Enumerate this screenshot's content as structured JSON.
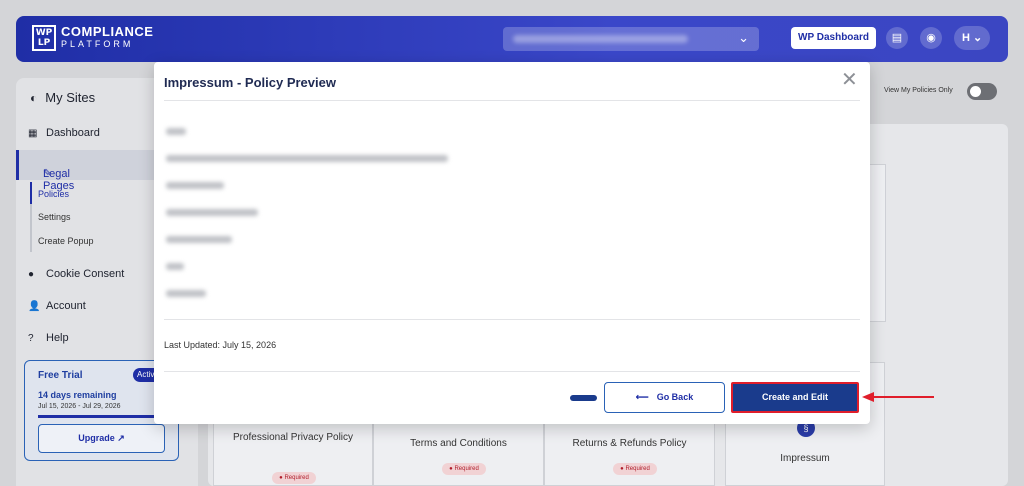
{
  "header": {
    "logo_mark": "WP LP",
    "logo_line1": "COMPLIANCE",
    "logo_line2": "PLATFORM",
    "wp_dashboard": "WP Dashboard",
    "user_initial": "H",
    "doc_icon": "document-icon",
    "support_icon": "support-icon"
  },
  "sidebar": {
    "my_sites": "My Sites",
    "items": [
      {
        "label": "Dashboard",
        "icon": "grid-icon"
      },
      {
        "label": "Legal Pages",
        "icon": "gavel-icon"
      },
      {
        "label": "Cookie Consent",
        "icon": "cookie-icon"
      },
      {
        "label": "Account",
        "icon": "user-icon"
      },
      {
        "label": "Help",
        "icon": "help-icon"
      }
    ],
    "subitems": [
      "Policies",
      "Settings",
      "Create Popup"
    ],
    "trial": {
      "title": "Free Trial",
      "badge": "Activ",
      "remaining": "14 days remaining",
      "dates": "Jul 15, 2026 - Jul 29, 2026",
      "upgrade": "Upgrade"
    }
  },
  "toolbar": {
    "view_my_policies": "View My Policies Only"
  },
  "cards": [
    {
      "title": "Professional Privacy Policy",
      "tag": "Required"
    },
    {
      "title": "Terms and Conditions",
      "tag": "Required"
    },
    {
      "title": "Returns & Refunds Policy",
      "tag": "Required"
    },
    {
      "title": "Impressum",
      "icon": "section-icon"
    }
  ],
  "modal": {
    "title": "Impressum - Policy Preview",
    "last_updated": "Last Updated: July 15, 2026",
    "go_back": "Go Back",
    "create_edit": "Create and Edit"
  },
  "colors": {
    "brand": "#1f2ea6",
    "primary_button": "#1a3b8c",
    "highlight": "#e01e2b"
  }
}
